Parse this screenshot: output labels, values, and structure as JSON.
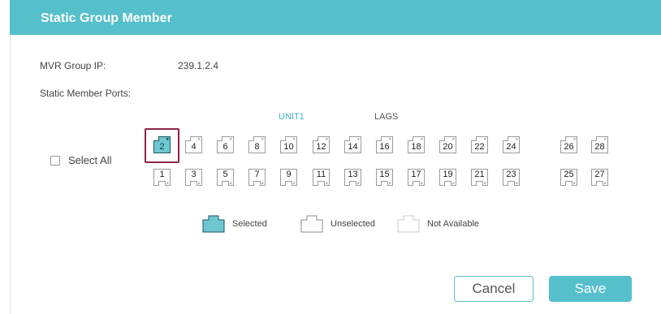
{
  "header": {
    "title": "Static Group Member"
  },
  "form": {
    "group_ip_label": "MVR Group IP:",
    "group_ip_value": "239.1.2.4",
    "member_ports_label": "Static Member Ports:"
  },
  "tabs": {
    "unit": "UNIT1",
    "lags": "LAGS"
  },
  "select_all_label": "Select All",
  "ports_top": [
    "2",
    "4",
    "6",
    "8",
    "10",
    "12",
    "14",
    "16",
    "18",
    "20",
    "22",
    "24",
    "26",
    "28"
  ],
  "ports_bottom": [
    "1",
    "3",
    "5",
    "7",
    "9",
    "11",
    "13",
    "15",
    "17",
    "19",
    "21",
    "23",
    "25",
    "27"
  ],
  "selected_ports": [
    "2"
  ],
  "legend": {
    "selected": "Selected",
    "unselected": "Unselected",
    "not_available": "Not Available"
  },
  "buttons": {
    "cancel": "Cancel",
    "save": "Save"
  },
  "colors": {
    "accent": "#55c0cc",
    "highlight_border": "#8e2347",
    "selected_fill": "#6ec7d1"
  }
}
